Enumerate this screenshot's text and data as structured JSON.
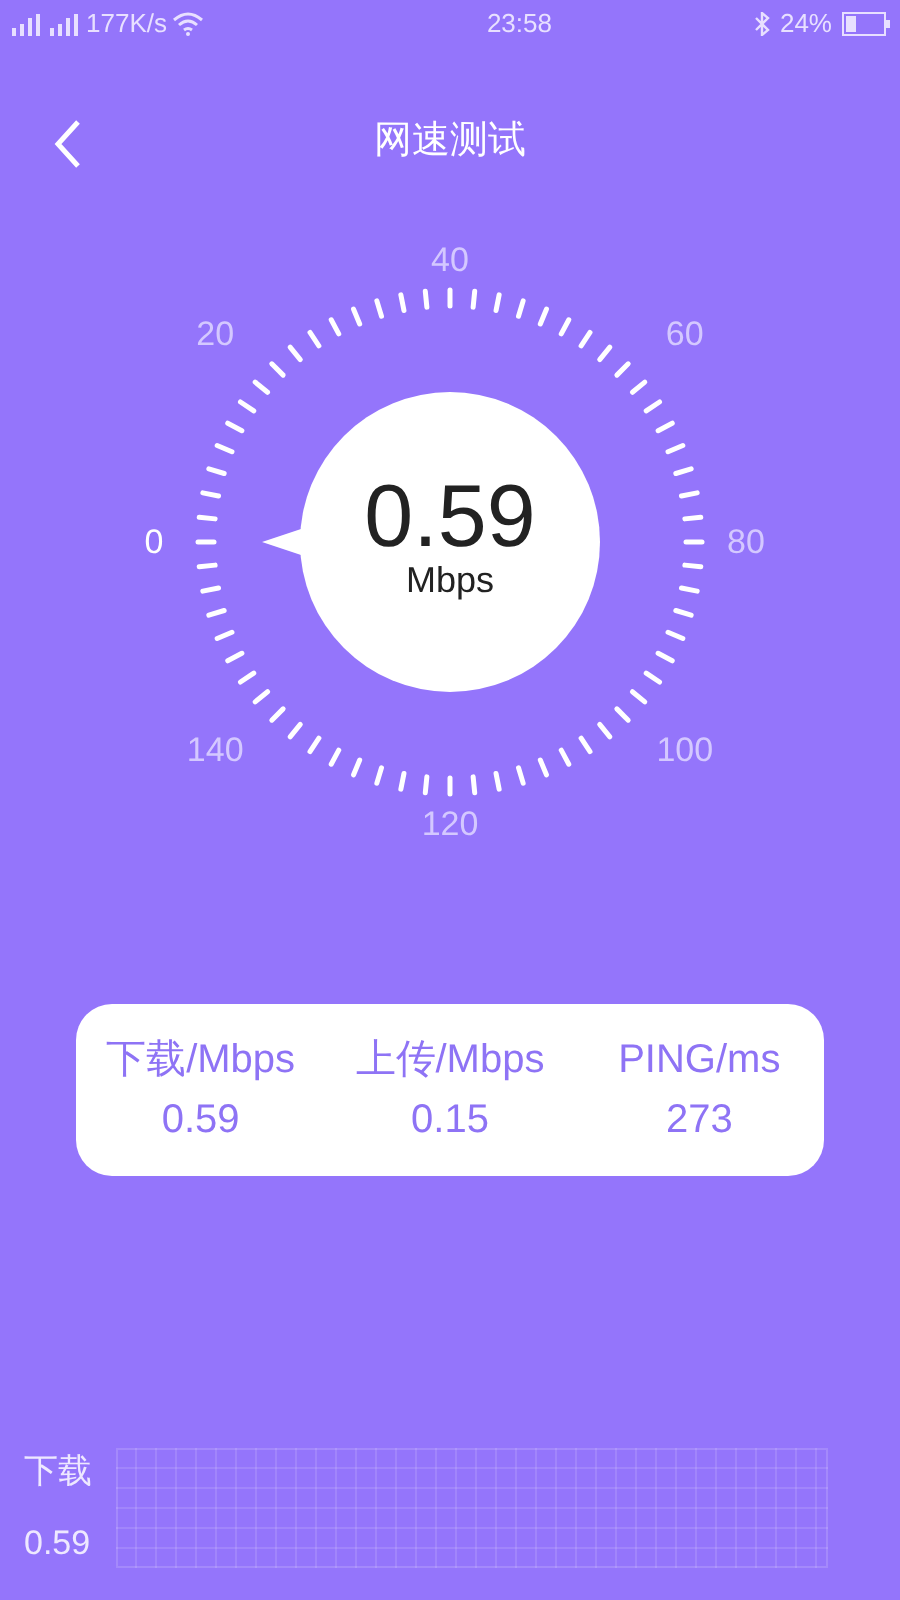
{
  "status_bar": {
    "speed": "177K/s",
    "time": "23:58",
    "battery": "24%"
  },
  "header": {
    "title": "网速测试"
  },
  "gauge": {
    "value": "0.59",
    "unit": "Mbps",
    "labels": [
      {
        "text": "0",
        "selected": true
      },
      {
        "text": "20",
        "selected": false
      },
      {
        "text": "40",
        "selected": false
      },
      {
        "text": "60",
        "selected": false
      },
      {
        "text": "80",
        "selected": false
      },
      {
        "text": "100",
        "selected": false
      },
      {
        "text": "120",
        "selected": false
      },
      {
        "text": "140",
        "selected": false
      }
    ]
  },
  "stats": [
    {
      "label": "下载/Mbps",
      "value": "0.59"
    },
    {
      "label": "上传/Mbps",
      "value": "0.15"
    },
    {
      "label": "PING/ms",
      "value": "273"
    }
  ],
  "graph": {
    "label": "下载",
    "value": "0.59"
  }
}
